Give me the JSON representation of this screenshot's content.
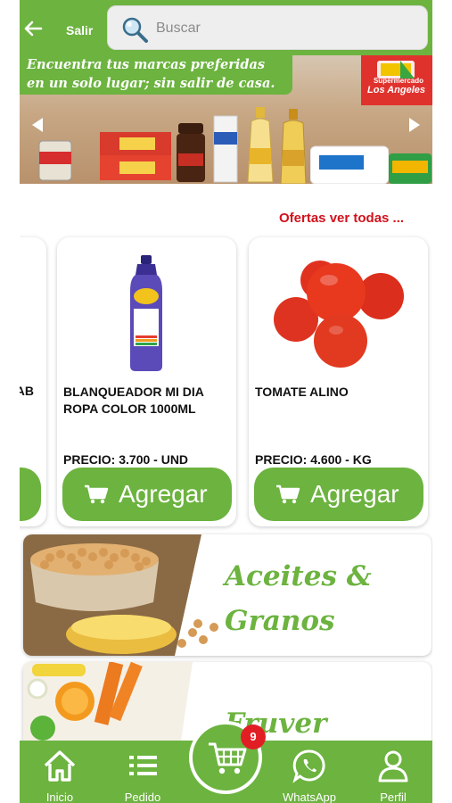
{
  "header": {
    "back_label": "Salir",
    "search_placeholder": "Buscar",
    "search_value": ""
  },
  "banner": {
    "line1": "Encuentra tus marcas preferidas",
    "line2": "en un solo lugar; sin salir de casa.",
    "brand_top": "Supermercado",
    "brand_name": "Los Angeles"
  },
  "offers": {
    "link_label": "Ofertas ver todas ...",
    "partial_product_name": "AB",
    "products": [
      {
        "name_line1": "BLANQUEADOR MI DIA",
        "name_line2": "ROPA COLOR 1000ML",
        "price": "PRECIO: 3.700 - UND",
        "button_label": "Agregar"
      },
      {
        "name_line1": "TOMATE ALINO",
        "name_line2": "",
        "price": "PRECIO: 4.600 - KG",
        "button_label": "Agregar"
      }
    ]
  },
  "categories": [
    {
      "title_line1": "Aceites &",
      "title_line2": "Granos"
    },
    {
      "title_line1": "Fruver"
    }
  ],
  "bottom_nav": {
    "items": [
      {
        "label": "Inicio",
        "icon": "home-icon"
      },
      {
        "label": "Pedido",
        "icon": "list-icon"
      },
      {
        "label": "WhatsApp",
        "icon": "whatsapp-icon"
      },
      {
        "label": "Perfil",
        "icon": "user-icon"
      }
    ],
    "cart_count": "9"
  },
  "colors": {
    "brand_green": "#6cb33f",
    "link_red": "#d1121c",
    "badge_red": "#e21e25"
  }
}
